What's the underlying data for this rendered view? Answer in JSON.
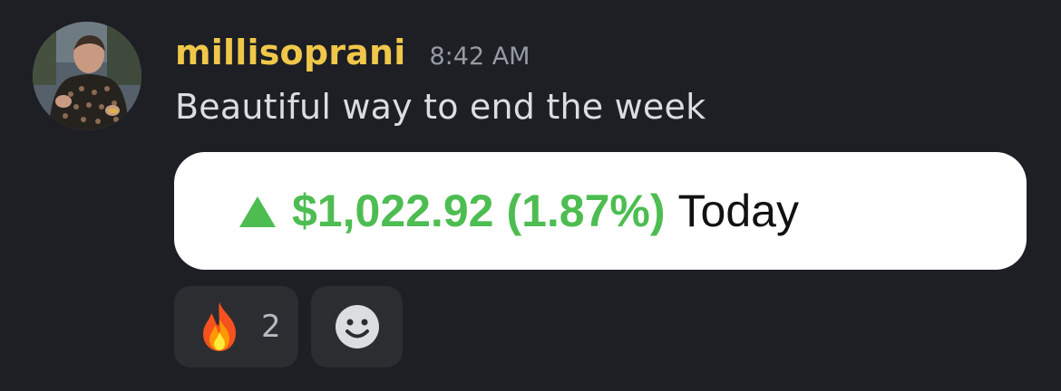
{
  "message": {
    "username": "millisoprani",
    "timestamp": "8:42 AM",
    "text": "Beautiful way to end the week",
    "avatar_icon": "user-avatar",
    "username_color": "#f0c74a"
  },
  "attachment": {
    "direction_icon": "up-triangle-icon",
    "gain_amount": "$1,022.92",
    "gain_percent": "(1.87%)",
    "period": "Today",
    "gain_color": "#4dbd52"
  },
  "reactions": [
    {
      "icon": "fire-emoji-icon",
      "count": "2"
    }
  ],
  "add_reaction_icon": "smile-icon"
}
